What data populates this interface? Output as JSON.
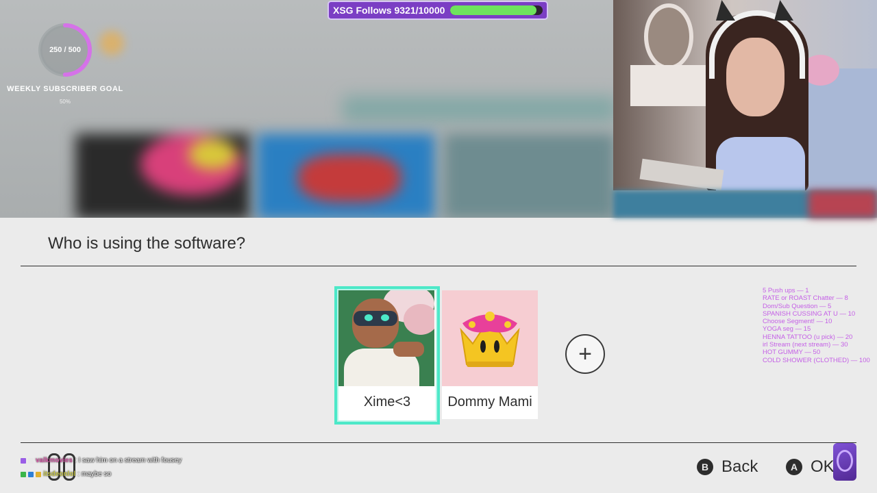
{
  "overlay": {
    "follows_label": "XSG Follows 9321/10000",
    "follows_fraction": 0.9321,
    "sub_goal_count": "250 / 500",
    "sub_goal_fraction": 0.5,
    "sub_goal_title": "WEEKLY SUBSCRIBER GOAL",
    "sub_goal_percent": "50%"
  },
  "screen": {
    "title": "Who is using the software?"
  },
  "users": [
    {
      "name": "Xime<3",
      "selected": true
    },
    {
      "name": "Dommy Mami",
      "selected": false
    }
  ],
  "add_user_symbol": "+",
  "redeems": [
    "5 Push ups — 1",
    "RATE or ROAST Chatter — 8",
    "Dom/Sub Question — 5",
    "SPANISH CUSSING AT U — 10",
    "Choose Segment! — 10",
    "YOGA seg — 15",
    "HENNA TATTOO (u pick) — 20",
    "irl Stream (next stream) — 30",
    "HOT GUMMY — 50",
    "COLD SHOWER (CLOTHED) — 100"
  ],
  "nav": {
    "back_key": "B",
    "back_label": "Back",
    "ok_key": "A",
    "ok_label": "OK"
  },
  "chat": [
    {
      "user": "valkmovies",
      "user_color": "#d75aa8",
      "message": ": I saw him on a stream with fousey"
    },
    {
      "user": "itsdeonlol",
      "user_color": "#c8c84a",
      "message": ": maybe so"
    }
  ],
  "colors": {
    "accent_selected": "#4ce8c8",
    "follows_bar": "#7b3ec4",
    "follows_fill": "#6ee35d",
    "goal_ring": "#d572e8",
    "redeem_text": "#c45fe6"
  }
}
